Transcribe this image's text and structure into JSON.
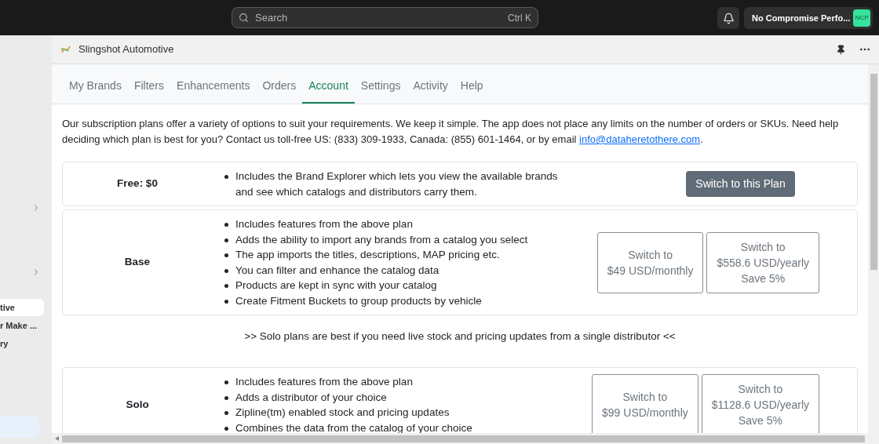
{
  "topbar": {
    "search": {
      "placeholder": "Search",
      "shortcut": "Ctrl K"
    },
    "account": {
      "name": "No Compromise Perfo...",
      "initials": "NCP"
    }
  },
  "sidebar": {
    "items": [
      {
        "label": "tive",
        "selected": true
      },
      {
        "label": "r Make ...",
        "selected": false
      },
      {
        "label": "ry",
        "selected": false
      }
    ]
  },
  "app": {
    "title": "Slingshot Automotive"
  },
  "tabs": [
    {
      "label": "My Brands",
      "selected": false
    },
    {
      "label": "Filters",
      "selected": false
    },
    {
      "label": "Enhancements",
      "selected": false
    },
    {
      "label": "Orders",
      "selected": false
    },
    {
      "label": "Account",
      "selected": true
    },
    {
      "label": "Settings",
      "selected": false
    },
    {
      "label": "Activity",
      "selected": false
    },
    {
      "label": "Help",
      "selected": false
    }
  ],
  "intro": {
    "text": "Our subscription plans offer a variety of options to suit your requirements. We keep it simple. The app does not place any limits on the number of orders or SKUs. Need help deciding which plan is best for you? Contact us toll-free US: (833) 309-1933, Canada: (855) 601-1464, or by email",
    "link": "info@dataheretothere.com",
    "after": "."
  },
  "plans": [
    {
      "kind": "plan",
      "name": "Free: $0",
      "features": [
        "Includes the Brand Explorer which lets you view the available brands and see which catalogs and distributors carry them."
      ],
      "buttons": [
        {
          "kind": "primary",
          "lines": [
            "Switch to this Plan"
          ]
        }
      ]
    },
    {
      "kind": "plan",
      "name": "Base",
      "features": [
        "Includes features from the above plan",
        "Adds the ability to import any brands from a catalog you select",
        "The app imports the titles, descriptions, MAP pricing etc.",
        "You can filter and enhance the catalog data",
        "Products are kept in sync with your catalog",
        "Create Fitment Buckets to group products by vehicle"
      ],
      "buttons": [
        {
          "kind": "outline",
          "lines": [
            "Switch to",
            "$49 USD/monthly"
          ]
        },
        {
          "kind": "outline",
          "lines": [
            "Switch to",
            "$558.6 USD/yearly",
            "Save 5%"
          ]
        }
      ]
    },
    {
      "kind": "note",
      "text": ">> Solo plans are best if you need live stock and pricing updates from a single distributor <<"
    },
    {
      "kind": "plan",
      "name": "Solo",
      "features": [
        "Includes features from the above plan",
        "Adds a distributor of your choice",
        "Zipline(tm) enabled stock and pricing updates",
        "Combines the data from the catalog of your choice"
      ],
      "buttons": [
        {
          "kind": "outline",
          "lines": [
            "Switch to",
            "$99 USD/monthly"
          ]
        },
        {
          "kind": "outline",
          "lines": [
            "Switch to",
            "$1128.6 USD/yearly",
            "Save 5%"
          ]
        }
      ]
    }
  ]
}
